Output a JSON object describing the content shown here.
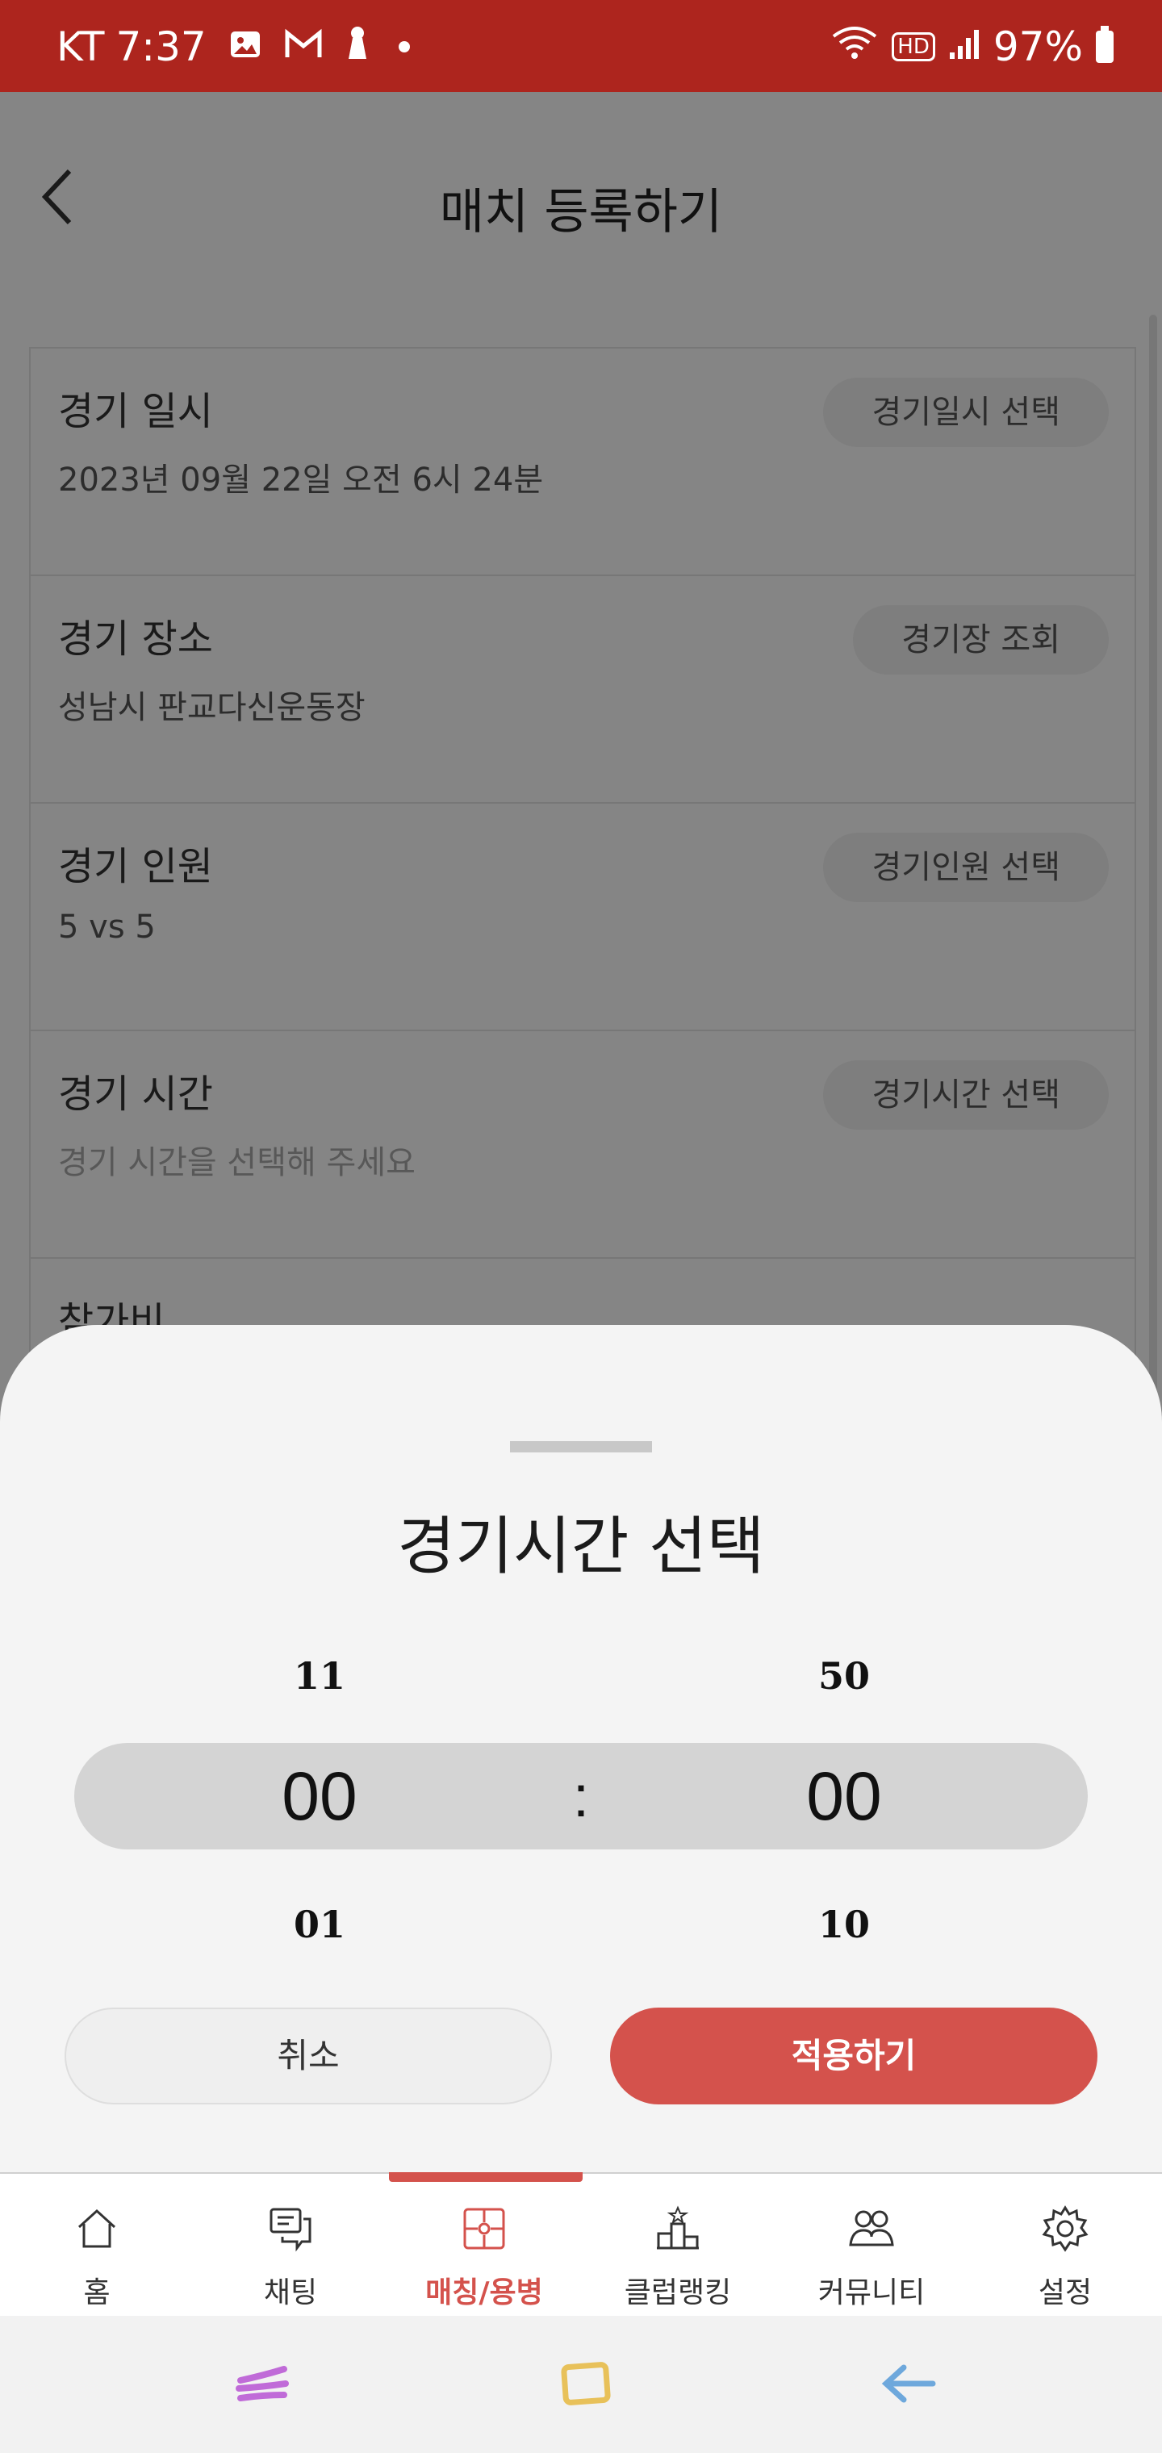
{
  "status_bar": {
    "carrier": "KT",
    "time": "7:37",
    "battery_pct": "97%",
    "network": "HD"
  },
  "page": {
    "title": "매치 등록하기",
    "rows": [
      {
        "label": "경기 일시",
        "value": "2023년 09월 22일 오전 6시 24분",
        "button": "경기일시 선택",
        "placeholder": false
      },
      {
        "label": "경기 장소",
        "value": "성남시 판교다신운동장",
        "button": "경기장 조회",
        "placeholder": false
      },
      {
        "label": "경기 인원",
        "value": "5 vs 5",
        "button": "경기인원 선택",
        "placeholder": false
      },
      {
        "label": "경기 시간",
        "value": "경기 시간을 선택해 주세요",
        "button": "경기시간 선택",
        "placeholder": true
      },
      {
        "label": "참가비",
        "value": "",
        "button": "",
        "placeholder": false
      }
    ]
  },
  "sheet": {
    "title": "경기시간 선택",
    "hours": {
      "prev": "11",
      "selected": "00",
      "next": "01"
    },
    "separator": ":",
    "minutes": {
      "prev": "50",
      "selected": "00",
      "next": "10"
    },
    "cancel_label": "취소",
    "apply_label": "적용하기"
  },
  "nav": {
    "active_index": 2,
    "items": [
      {
        "label": "홈",
        "icon": "home-icon"
      },
      {
        "label": "채팅",
        "icon": "chat-icon"
      },
      {
        "label": "매칭/용병",
        "icon": "puzzle-icon"
      },
      {
        "label": "클럽랭킹",
        "icon": "podium-icon"
      },
      {
        "label": "커뮤니티",
        "icon": "community-icon"
      },
      {
        "label": "설정",
        "icon": "gear-icon"
      }
    ]
  },
  "colors": {
    "status_bar": "#ad251e",
    "accent": "#d4524c"
  }
}
